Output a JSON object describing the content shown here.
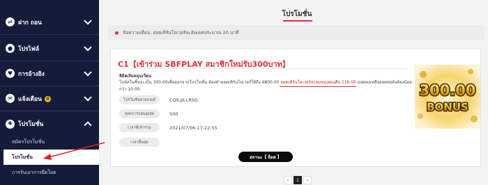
{
  "sidebar": {
    "items": [
      {
        "label": "ฝาก ถอน",
        "icon": "exchange-icon",
        "glyph": "⇄"
      },
      {
        "label": "โปรไฟล์",
        "icon": "user-icon",
        "glyph": "●"
      },
      {
        "label": "การอ้างอิง",
        "icon": "heart-icon",
        "glyph": "♥"
      },
      {
        "label": "แจ้งเตือน",
        "icon": "mail-icon",
        "glyph": "✉",
        "badge": "0"
      },
      {
        "label": "โปรโมชั่น",
        "icon": "gift-icon",
        "glyph": "✚"
      }
    ],
    "sub_items": [
      {
        "label": "สมัครโปรโมชั่น"
      },
      {
        "label": "โปรโมชั่น"
      },
      {
        "label": "การรับเอาการยืดโยด"
      }
    ]
  },
  "page": {
    "title": "โปรโมชั่น",
    "notice": "ข้อความเตือน: ยอดเทิร์นโอเวอร์จะอัพเดตประมาณ 20 นาที"
  },
  "promo": {
    "title": "C1【เข้าร่วม SBFPLAY สมาชิกใหม่รับ300บาท】",
    "desc_head": "ลิมิตเงินหมุนเวียน",
    "desc_part1": "โบนัสในชิ้นจะเป็น 300.00เพื่อออกจากโปรโมชั่น ต้องทำยอดเทิร์นโอเวอร์ให้ถึง 4800.00",
    "desc_part2": "ยอดเทิร์นโอเวอร์สะสมของคุณคือ 116.00",
    "desc_part3": "ยอดคงเหลือยอดต่อยังต้องน้อยกว่า 10.00.",
    "rows": [
      {
        "label": "โปรโมชั่นค่ายเกมส์",
        "value": "CQ9,JILI,RSG"
      },
      {
        "label": "ยอดการถอนสูงสุด",
        "value": "500"
      },
      {
        "label": "เวลาที่เข้าร่วม",
        "value": "2021/07/06 17:22:55"
      },
      {
        "label": "เวลาสิ้นสุด",
        "value": ""
      }
    ],
    "status_button": "สถานะ【 ล็อค 】",
    "banner_amount": "300.00",
    "banner_word": "BONUS"
  },
  "pager": {
    "prev": "‹",
    "current": "1",
    "next": "›"
  },
  "colors": {
    "sidebar_bg": "#151c3a",
    "accent_red": "#d8333a",
    "banner_gold": "#f2b51c"
  }
}
